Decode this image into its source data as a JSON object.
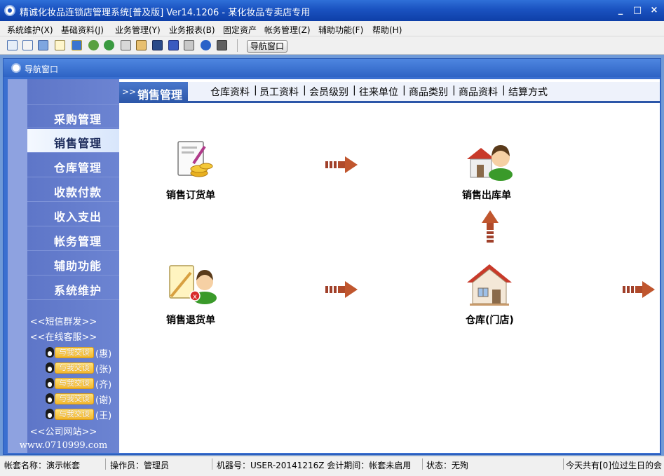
{
  "window": {
    "title": "精诚化妆品连锁店管理系统[普及版] Ver14.1206  -  某化妆品专卖店专用",
    "minimize": "_",
    "maximize": "□",
    "close": "×"
  },
  "menu": [
    "系统维护(X)",
    "基础资料(J)",
    "业务管理(Y)",
    "业务报表(B)",
    "固定资产",
    "帐务管理(Z)",
    "辅助功能(F)",
    "帮助(H)"
  ],
  "toolbar": {
    "icons": [
      "table-icon",
      "form-icon",
      "windows-icon",
      "notepad-icon",
      "chart-icon",
      "refresh-icon",
      "users-icon",
      "print-preview-icon",
      "export-icon",
      "screen-icon",
      "save-icon",
      "print-icon",
      "help-icon",
      "exit-icon"
    ],
    "nav_button": "导航窗口"
  },
  "nav_window": {
    "title": "导航窗口"
  },
  "sidebar": {
    "items": [
      "采购管理",
      "销售管理",
      "仓库管理",
      "收款付款",
      "收入支出",
      "帐务管理",
      "辅助功能",
      "系统维护"
    ],
    "active_index": 1,
    "sms_link": "<<短信群发>>",
    "online_service": "<<在线客服>>",
    "qq_label": "与我交谈",
    "qq_contacts": [
      "(惠)",
      "(张)",
      "(齐)",
      "(谢)",
      "(王)"
    ],
    "company_link": "<<公司网站>>",
    "website": "www.0710999.com"
  },
  "main": {
    "arrow_prefix": ">>",
    "current_tab": "销售管理",
    "links": [
      "仓库资料",
      "|",
      "员工资料",
      "|",
      "会员级别",
      "|",
      "往来单位",
      "|",
      "商品类别",
      "|",
      "商品资料",
      "|",
      "结算方式"
    ],
    "nodes": {
      "sales_order": "销售订货单",
      "sales_out": "销售出库单",
      "sales_return": "销售退货单",
      "warehouse": "仓库(门店)"
    }
  },
  "status": {
    "account_name": "帐套名称：演示帐套",
    "operator": "操作员：管理员",
    "machine": "机器号：USER-20141216Z 会计期间：帐套未启用",
    "state": "状态：无殉",
    "birthday": "今天共有[0]位过生日的会"
  },
  "colors": {
    "title_bar": "#1a52c0",
    "sidebar": "#6c84d2",
    "tab_active": "#2c56a8",
    "arrow": "#b04a2a"
  }
}
